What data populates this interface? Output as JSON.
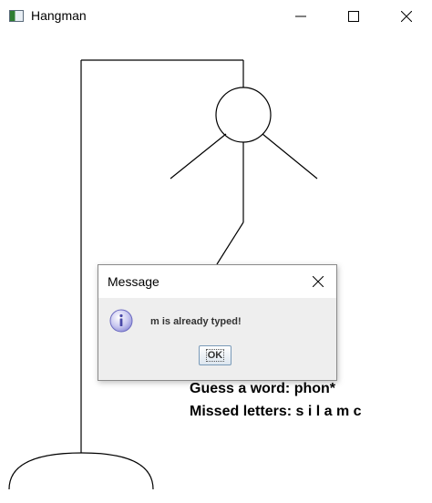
{
  "window": {
    "title": "Hangman",
    "icon": "app-window-icon",
    "controls": [
      "minimize-icon",
      "maximize-icon",
      "close-icon"
    ]
  },
  "game": {
    "guess_text": "Guess a word: phon*",
    "missed_text": "Missed letters: s i l a m c",
    "drawing_icon": "hangman-drawing"
  },
  "dialog": {
    "title": "Message",
    "message": "m is already typed!",
    "ok_label": "OK",
    "icon": "info-icon",
    "close_icon": "close-icon"
  }
}
